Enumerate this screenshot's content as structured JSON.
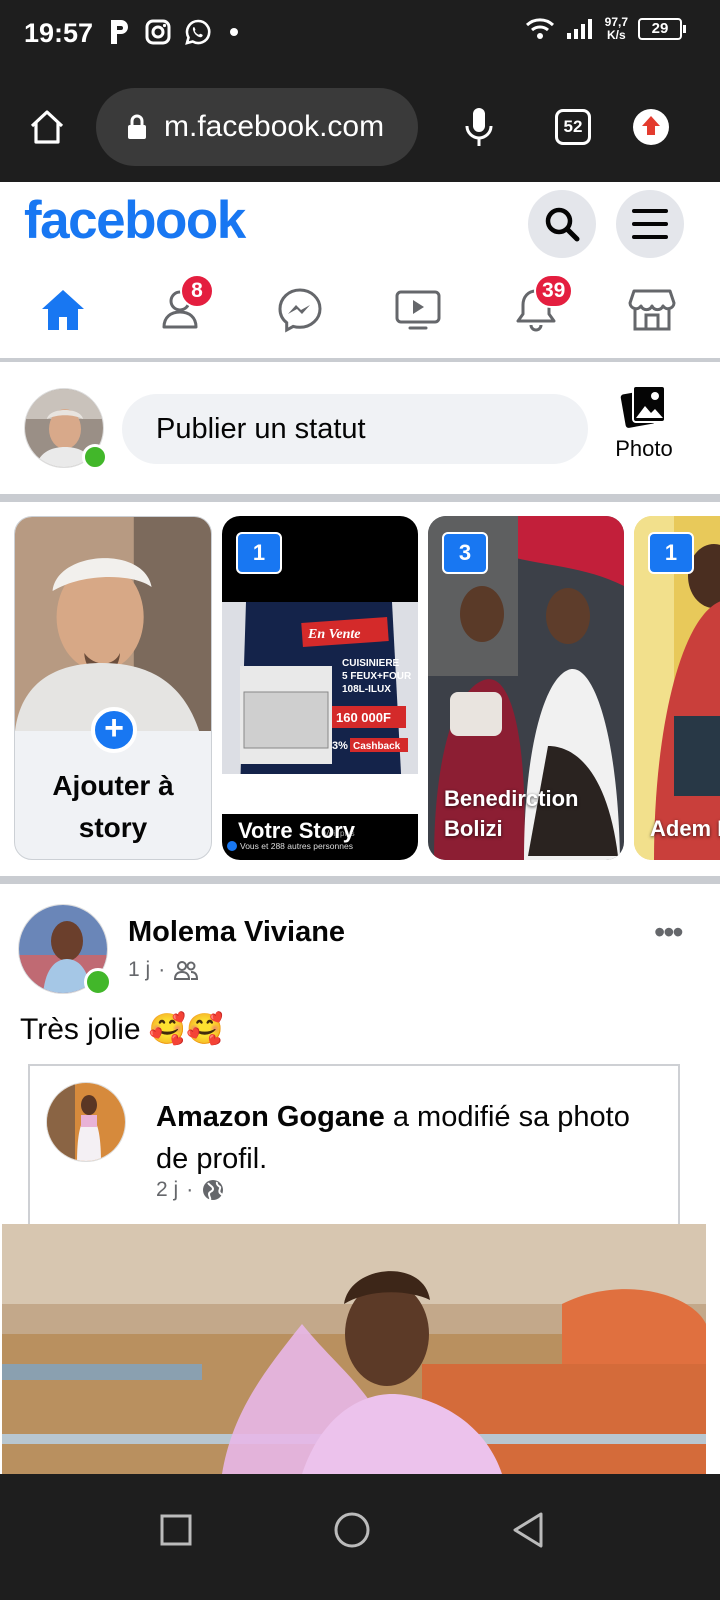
{
  "status_bar": {
    "time": "19:57",
    "speed_value": "97,7",
    "speed_unit": "K/s",
    "battery": "29"
  },
  "browser": {
    "url": "m.facebook.com",
    "tab_count": "52"
  },
  "header": {
    "logo": "facebook",
    "brand_color": "#1877f2"
  },
  "nav": {
    "friends_badge": "8",
    "notifications_badge": "39"
  },
  "composer": {
    "placeholder": "Publier un statut",
    "photo_label": "Photo"
  },
  "stories": [
    {
      "type": "create",
      "label": "Ajouter à story"
    },
    {
      "count": "1",
      "name": "Votre Story"
    },
    {
      "count": "3",
      "name": "Benedirction Bolizi"
    },
    {
      "count": "1",
      "name": "Adem Nomb"
    }
  ],
  "story_ad": {
    "en_vente": "En Vente",
    "product": "CUISINIERE 5 FEUX+FOUR 108L-ILUX",
    "price": "160 000F",
    "cashback_pct": "3%",
    "cashback": "Cashback",
    "footer": "Vous et 288 autres personnes",
    "voir_plus": "Voir plus"
  },
  "post": {
    "author": "Molema Viviane",
    "time": "1 j",
    "text": "Très jolie 🥰🥰",
    "shared": {
      "author": "Amazon Gogane",
      "action": " a modifié sa photo de profil.",
      "time": "2 j"
    }
  }
}
